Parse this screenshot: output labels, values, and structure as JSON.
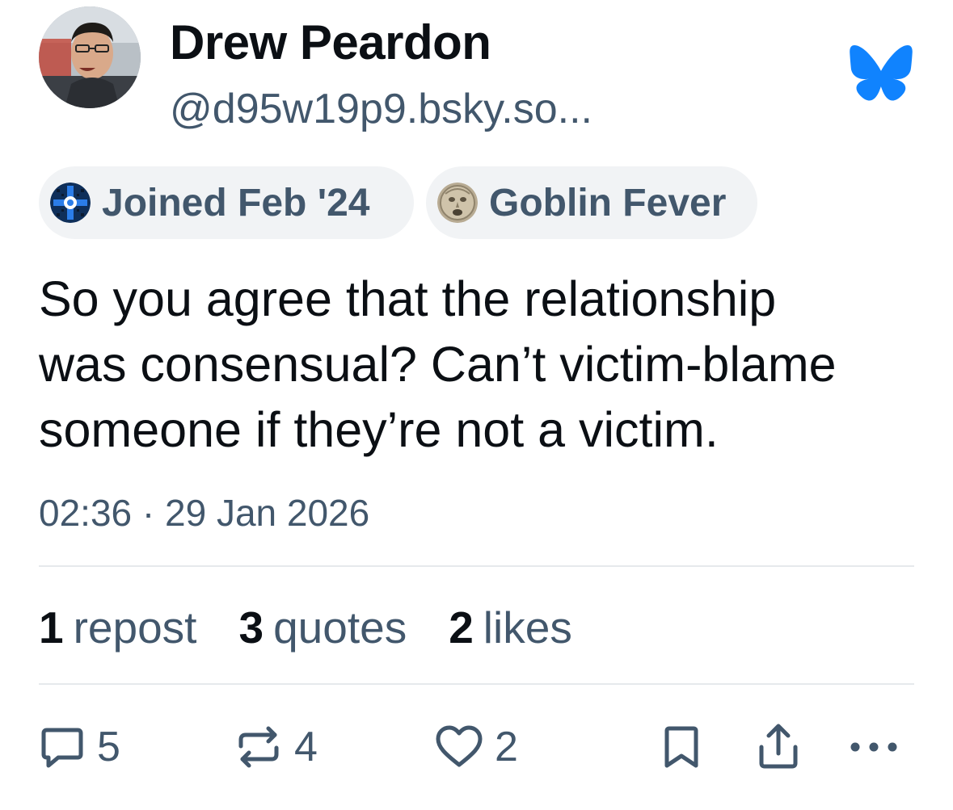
{
  "author": {
    "display_name": "Drew Peardon",
    "handle": "@d95w19p9.bsky.so..."
  },
  "brand": {
    "logo_icon": "butterfly-icon",
    "accent_color": "#1083fe"
  },
  "badges": [
    {
      "label": "Joined Feb '24",
      "icon": "joined-badge-icon"
    },
    {
      "label": "Goblin Fever",
      "icon": "goblin-fever-badge-icon"
    }
  ],
  "post": {
    "text": "So you agree that the relationship\nwas consensual? Can’t victim-blame\nsomeone if they’re not a victim.",
    "timestamp": "02:36 · 29 Jan 2026"
  },
  "stats": [
    {
      "count": "1",
      "label": "repost"
    },
    {
      "count": "3",
      "label": "quotes"
    },
    {
      "count": "2",
      "label": "likes"
    }
  ],
  "actions": {
    "reply": {
      "icon": "comment-icon",
      "count": "5"
    },
    "repost": {
      "icon": "repost-icon",
      "count": "4"
    },
    "like": {
      "icon": "heart-icon",
      "count": "2"
    },
    "bookmark": {
      "icon": "bookmark-icon"
    },
    "share": {
      "icon": "share-icon"
    },
    "more": {
      "icon": "more-options-icon"
    }
  },
  "colors": {
    "text_primary": "#0b0f14",
    "text_secondary": "#42576c",
    "badge_background": "#f1f3f5",
    "divider": "#e6e9ec"
  }
}
